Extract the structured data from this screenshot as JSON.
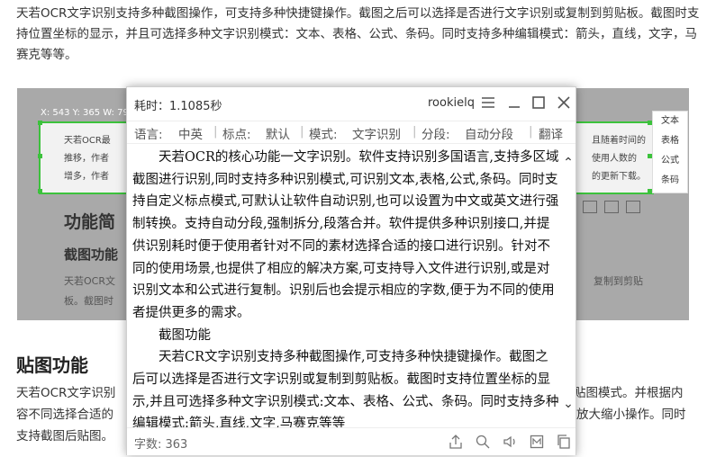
{
  "article": {
    "intro": "天若OCR文字识别支持多种截图操作，可支持多种快捷键操作。截图之后可以选择是否进行文字识别或复制到剪贴板。截图时支持位置坐标的显示，并且可选择多种文字识别模式：文本、表格、公式、条码。同时支持多种编辑模式：箭头，直线，文字，马赛克等等。",
    "screenshot": {
      "coords": "X: 543 Y: 365 W: 79",
      "sel_left_1": "天若OCR最",
      "sel_left_2": "推移，作者",
      "sel_left_3": "增多，作者",
      "sel_right_1": "且随着时间的",
      "sel_right_2": "使用人数的",
      "sel_right_3": "的更新下载。",
      "heading_big": "功能简",
      "heading_mid": "截图功能",
      "faded_1": "天若OCR文",
      "faded_1_right": "复制到剪贴",
      "faded_2": "板。截图时",
      "modes": [
        "文本",
        "表格",
        "公式",
        "条码"
      ]
    },
    "paste_heading": "贴图功能",
    "paste_line1_left": "天若OCR文字识别",
    "paste_line1_right": "贴图模式。并根据内",
    "paste_line2_left": "容不同选择合适的",
    "paste_line2_right": "放大缩小操作。同时",
    "paste_line3_left": "支持截图后贴图。",
    "paste_line3_right": ""
  },
  "window": {
    "elapsed": "耗时：1.1085秒",
    "user": "rookielq",
    "options": {
      "lang_label": "语言:",
      "lang_value": "中英",
      "punct_label": "标点:",
      "punct_value": "默认",
      "mode_label": "模式:",
      "mode_value": "文字识别",
      "seg_label": "分段:",
      "seg_value": "自动分段",
      "translate": "翻译"
    },
    "result_paragraphs": [
      "天若OCR的核心功能一文字识别。软件支持识别多国语言,支持多区域截图进行识别,同时支持多种识别模式,可识别文本,表格,公式,条码。同时支持自定义标点模式,可默认让软件自动识别,也可以设置为中文或英文进行强制转换。支持自动分段,强制拆分,段落合并。软件提供多种识别接口,并提供识别耗时便于使用者针对不同的素材选择合适的接口进行识别。针对不同的使用场景,也提供了相应的解决方案,可支持导入文件进行识别,或是对识别文本和公式进行复制。识别后也会提示相应的字数,便于为不同的使用者提供更多的需求。",
      "截图功能",
      "天若CR文字识别支持多种截图操作,可支持多种快捷键操作。截图之后可以选择是否进行文字识别或复制到剪贴板。截图时支持位置坐标的显示,并且可选择多种文字识别模式:文本、表格、公式、条码。同时支持多种编辑模式:箭头,直线,文字,马赛克等等"
    ],
    "char_count": "字数: 363"
  },
  "colors": {
    "selection": "#3cc23c",
    "overlay": "#a9a9a9"
  }
}
